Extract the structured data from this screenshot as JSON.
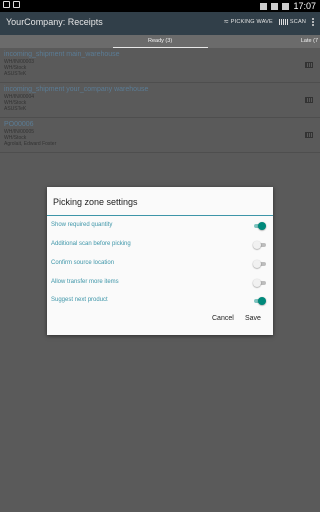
{
  "status": {
    "time": "17:07"
  },
  "appbar": {
    "title": "YourCompany: Receipts",
    "picking_wave_label": "PICKING WAVE",
    "scan_label": "SCAN"
  },
  "tabs": [
    {
      "label": "Ready (3)",
      "selected": true
    },
    {
      "label": "Late (7"
    }
  ],
  "receipts": [
    {
      "name": "incoming_shipment main_warehouse",
      "ref": "WH/IN/00003",
      "location": "WH/Stock",
      "partner": "ASUSTeK"
    },
    {
      "name": "incoming_shipment your_company warehouse",
      "ref": "WH/IN/00004",
      "location": "WH/Stock",
      "partner": "ASUSTeK"
    },
    {
      "name": "PO00006",
      "ref": "WH/IN/00005",
      "location": "WH/Stock",
      "partner": "Agrolait, Edward Foster"
    }
  ],
  "dialog": {
    "title": "Picking zone settings",
    "options": [
      {
        "label": "Show required quantity",
        "checked": true
      },
      {
        "label": "Additional scan before picking",
        "checked": false
      },
      {
        "label": "Confirm source location",
        "checked": false
      },
      {
        "label": "Allow transfer more items",
        "checked": false
      },
      {
        "label": "Suggest next product",
        "checked": true
      }
    ],
    "cancel_label": "Cancel",
    "save_label": "Save"
  },
  "colors": {
    "appbar": "#313f49",
    "accent": "#3d95a8",
    "toggle_on": "#00897b",
    "link": "#5a7c95"
  }
}
